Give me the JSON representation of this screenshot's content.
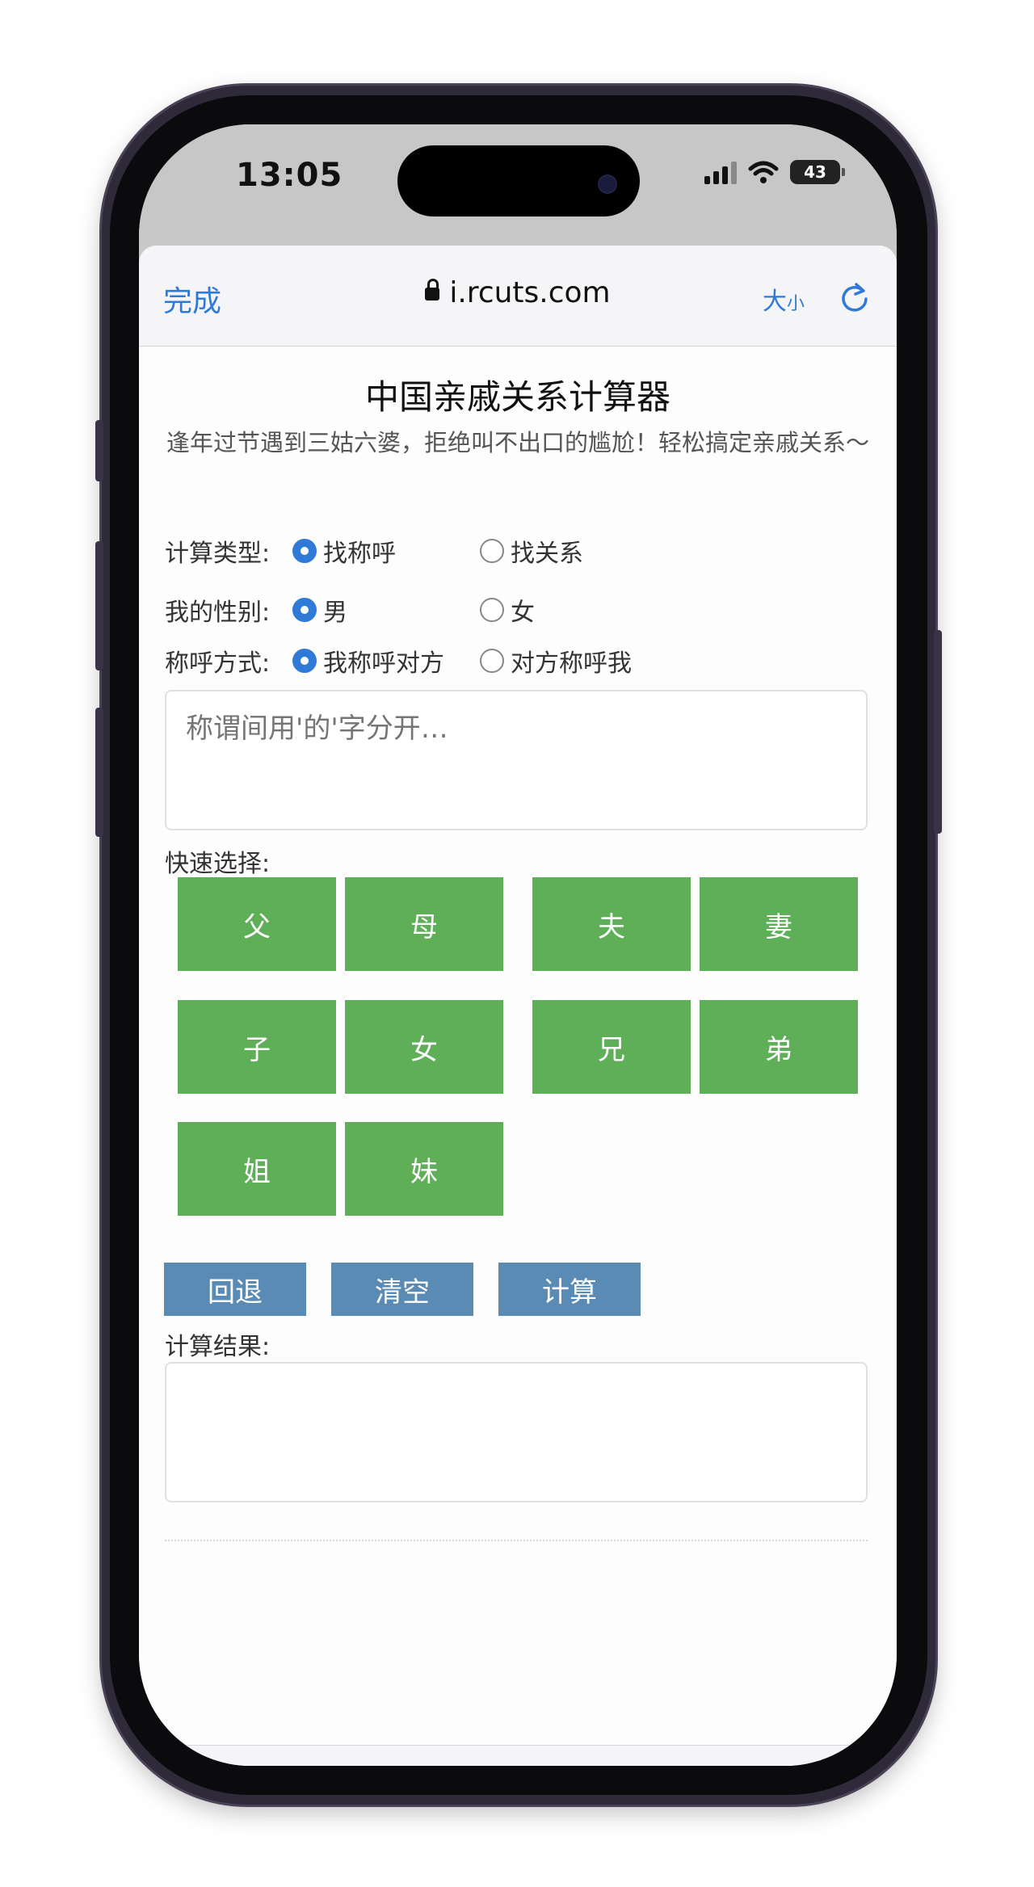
{
  "status_bar": {
    "time": "13:05",
    "battery": "43"
  },
  "browser": {
    "done_label": "完成",
    "url": "i.rcuts.com",
    "text_size_big": "大",
    "text_size_small": "小"
  },
  "page": {
    "title": "中国亲戚关系计算器",
    "subtitle": "逢年过节遇到三姑六婆，拒绝叫不出口的尴尬！轻松搞定亲戚关系～",
    "calc_type": {
      "label": "计算类型:",
      "options": [
        "找称呼",
        "找关系"
      ],
      "selected": "找称呼"
    },
    "gender": {
      "label": "我的性别:",
      "options": [
        "男",
        "女"
      ],
      "selected": "男"
    },
    "call_mode": {
      "label": "称呼方式:",
      "options": [
        "我称呼对方",
        "对方称呼我"
      ],
      "selected": "我称呼对方"
    },
    "input": {
      "placeholder": "称谓间用'的'字分开…",
      "value": ""
    },
    "quick_select_label": "快速选择:",
    "quick_buttons": [
      "父",
      "母",
      "夫",
      "妻",
      "子",
      "女",
      "兄",
      "弟",
      "姐",
      "妹"
    ],
    "actions": {
      "back": "回退",
      "clear": "清空",
      "calc": "计算"
    },
    "result_label": "计算结果:"
  },
  "colors": {
    "accent": "#2f7ad6",
    "quick_button": "#5fae58",
    "action_button": "#5a8bb4"
  }
}
